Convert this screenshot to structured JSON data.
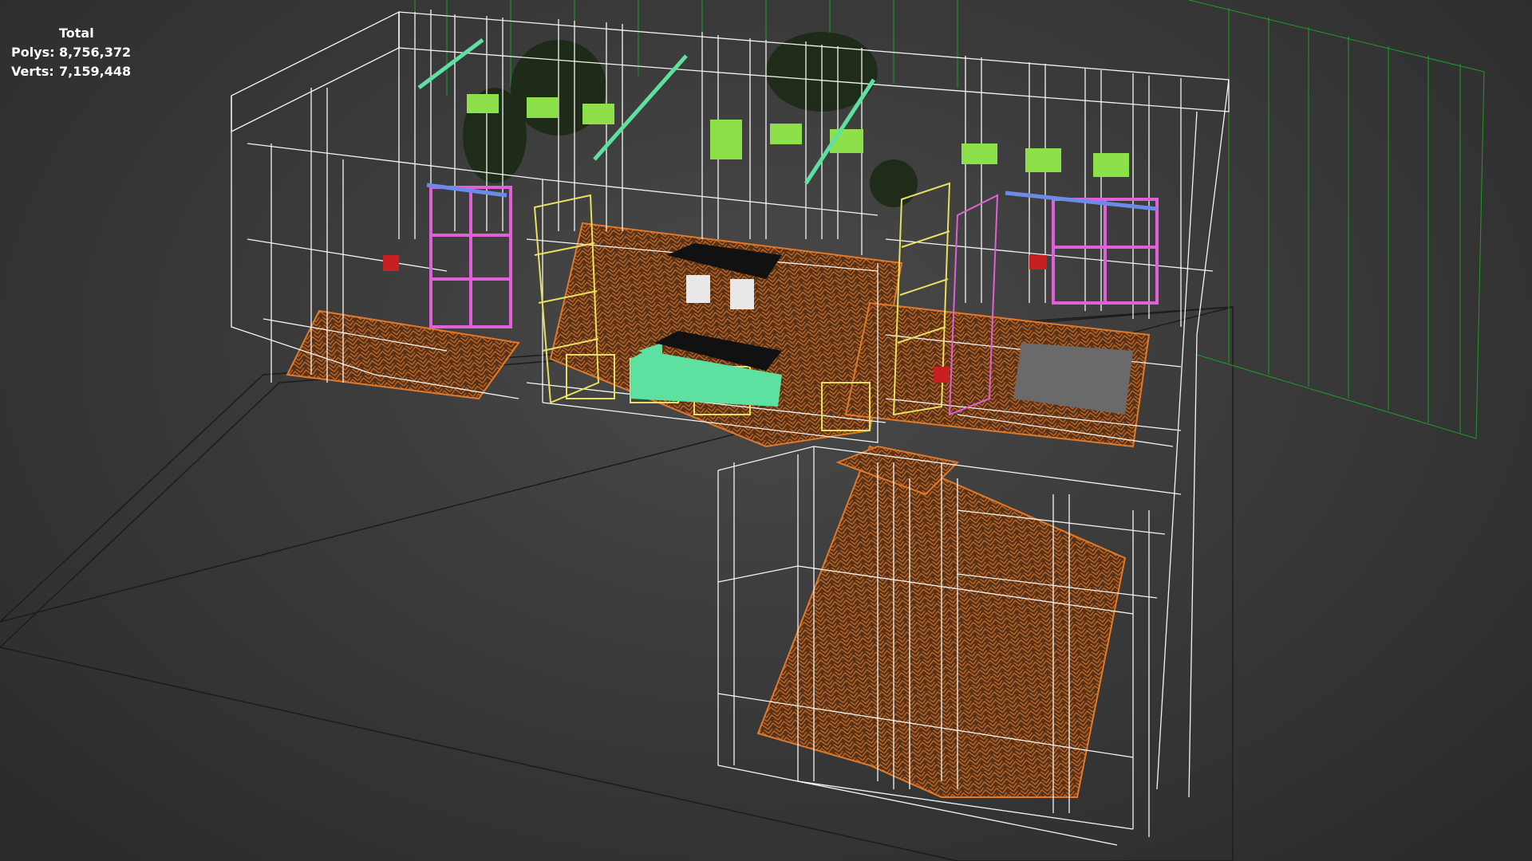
{
  "stats": {
    "title": "Total",
    "polys_label": "Polys:",
    "polys_value": "8,756,372",
    "verts_label": "Verts:",
    "verts_value": "7,159,448"
  },
  "viewport": {
    "mode": "wireframe perspective",
    "background_color": "#3a3a3a",
    "colors": {
      "wireframe": "#ffffff",
      "floor_lines": "#e07a2a",
      "window_panes": "#8ee04a",
      "shelf_yellow": "#e8e060",
      "shelf_pink": "#e060d8",
      "sofa": "#5ee0a0",
      "grid": "#1f9c2a"
    }
  }
}
